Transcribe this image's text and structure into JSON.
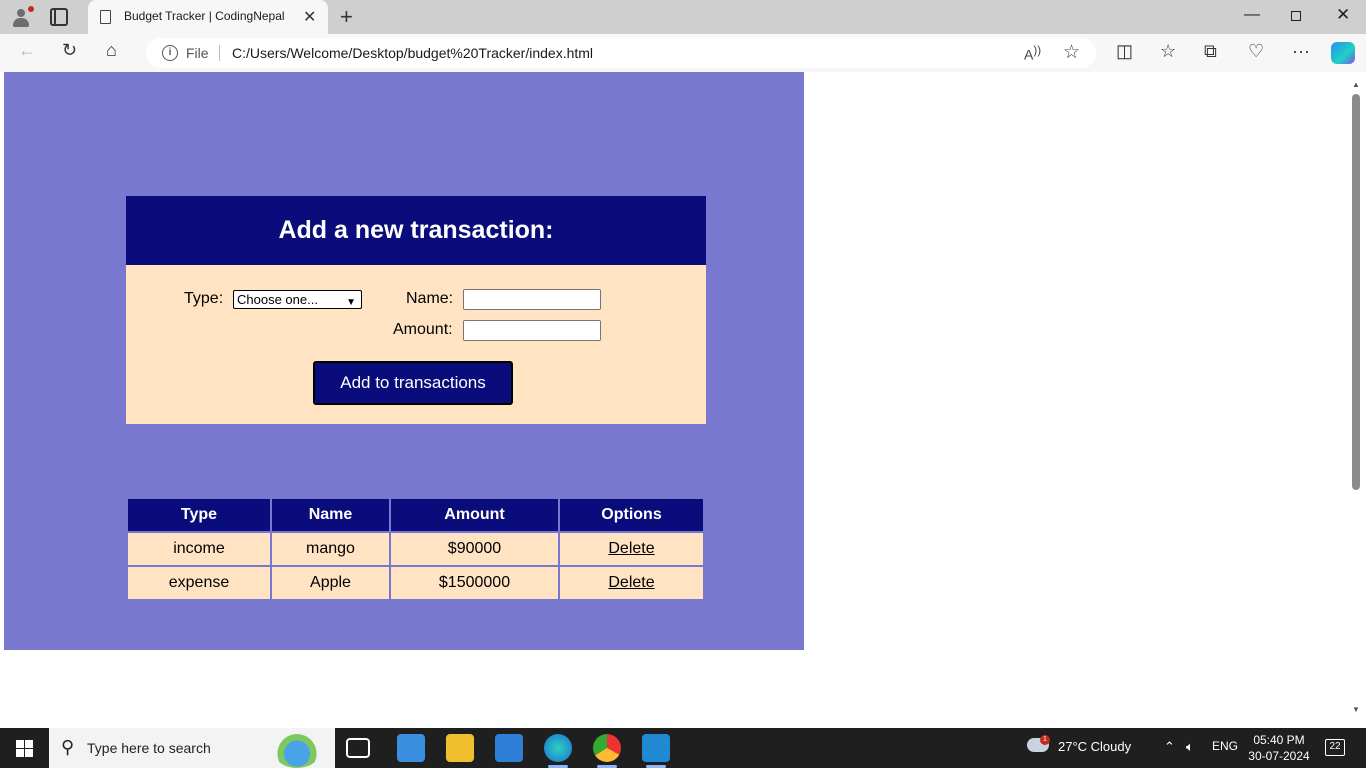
{
  "browser": {
    "tab_title": "Budget Tracker | CodingNepal",
    "address_label": "File",
    "url": "C:/Users/Welcome/Desktop/budget%20Tracker/index.html"
  },
  "form": {
    "heading": "Add a new transaction:",
    "type_label": "Type:",
    "type_selected": "Choose one...",
    "name_label": "Name:",
    "amount_label": "Amount:",
    "submit_label": "Add to transactions"
  },
  "table": {
    "headers": [
      "Type",
      "Name",
      "Amount",
      "Options"
    ],
    "rows": [
      {
        "type": "income",
        "name": "mango",
        "amount": "$90000",
        "option": "Delete"
      },
      {
        "type": "expense",
        "name": "Apple",
        "amount": "$1500000",
        "option": "Delete"
      }
    ]
  },
  "colors": {
    "page_background": "#7878cf",
    "header_navy": "#0b0c7c",
    "card_background": "#ffe3c2"
  },
  "taskbar": {
    "search_placeholder": "Type here to search",
    "weather": "27°C  Cloudy",
    "weather_badge": "1",
    "language": "ENG",
    "time": "05:40 PM",
    "date": "30-07-2024",
    "notifications": "22"
  }
}
